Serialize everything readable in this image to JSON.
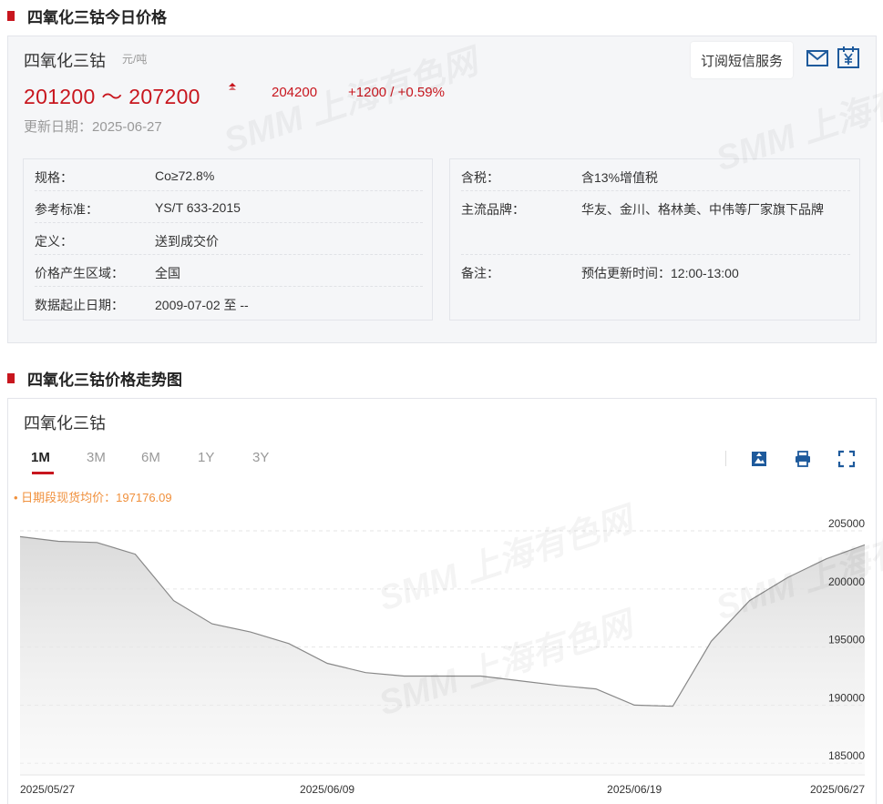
{
  "sections": {
    "today_title": "四氧化三钴今日价格",
    "trend_title": "四氧化三钴价格走势图"
  },
  "price": {
    "product_name": "四氧化三钴",
    "unit": "元/吨",
    "range": "201200 ～ 207200",
    "average": "204200",
    "change": "+1200 / +0.59%",
    "update_label": "更新日期：",
    "update_date": "2025-06-27",
    "subscribe_label": "订阅短信服务"
  },
  "info_left": [
    {
      "key": "规格：",
      "value": "Co≥72.8%"
    },
    {
      "key": "参考标准：",
      "value": "YS/T 633-2015"
    },
    {
      "key": "定义：",
      "value": "送到成交价"
    },
    {
      "key": "价格产生区域：",
      "value": "全国"
    },
    {
      "key": "数据起止日期：",
      "value": "2009-07-02 至 --"
    }
  ],
  "info_right": [
    {
      "key": "含税：",
      "value": "含13%增值税"
    },
    {
      "key": "主流品牌：",
      "value": "华友、金川、格林美、中伟等厂家旗下品牌"
    },
    {
      "key": "备注：",
      "value": "预估更新时间：12:00-13:00"
    }
  ],
  "chart_card": {
    "name": "四氧化三钴",
    "tabs": [
      "1M",
      "3M",
      "6M",
      "1Y",
      "3Y"
    ],
    "active_tab": "1M",
    "avg_legend": "日期段现货均价：197176.09"
  },
  "watermark": "SMM 上海有色网",
  "colors": {
    "accent": "#c8161e",
    "line": "#888888",
    "legend": "#f0903c",
    "icon": "#1e5a9c"
  },
  "chart_data": {
    "type": "area",
    "x": [
      "2025/05/27",
      "2025/05/28",
      "2025/05/29",
      "2025/05/30",
      "2025/06/03",
      "2025/06/04",
      "2025/06/05",
      "2025/06/06",
      "2025/06/09",
      "2025/06/10",
      "2025/06/11",
      "2025/06/12",
      "2025/06/13",
      "2025/06/16",
      "2025/06/17",
      "2025/06/18",
      "2025/06/19",
      "2025/06/20",
      "2025/06/23",
      "2025/06/24",
      "2025/06/25",
      "2025/06/26",
      "2025/06/27"
    ],
    "values": [
      204500,
      204100,
      204000,
      203000,
      199000,
      197000,
      196300,
      195300,
      193600,
      192800,
      192500,
      192500,
      192500,
      192100,
      191700,
      191400,
      190000,
      189900,
      195500,
      199000,
      201000,
      202600,
      203800
    ],
    "x_tick_labels": [
      "2025/05/27",
      "2025/06/09",
      "2025/06/19",
      "2025/06/27"
    ],
    "y_ticks": [
      185000,
      190000,
      195000,
      200000,
      205000
    ],
    "ylim": [
      184000,
      209000
    ],
    "grid": true,
    "y_axis_position": "right"
  }
}
